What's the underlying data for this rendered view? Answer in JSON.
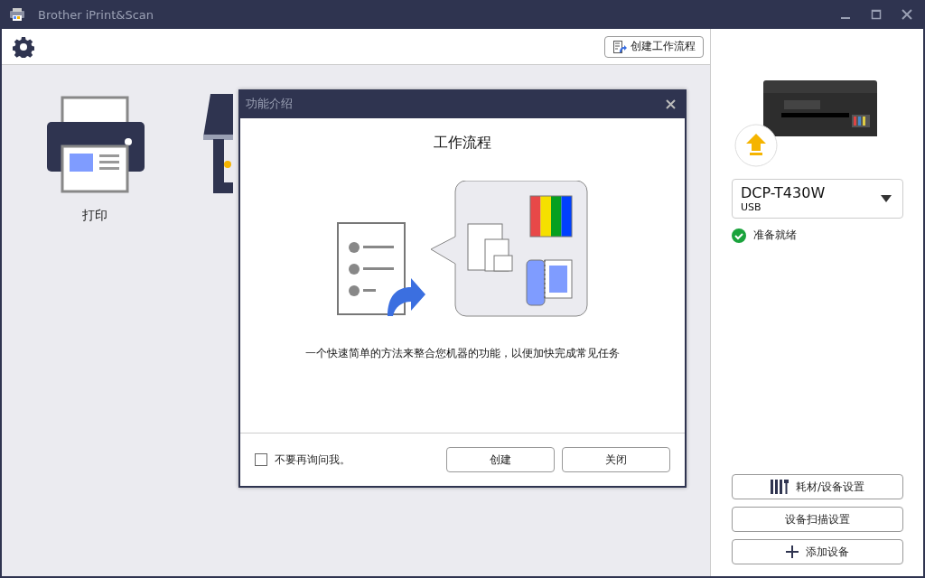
{
  "window": {
    "title": "Brother iPrint&Scan"
  },
  "toolbar": {
    "create_workflow_button": "创建工作流程"
  },
  "tiles": [
    {
      "label": "打印"
    }
  ],
  "dialog": {
    "title": "功能介绍",
    "heading": "工作流程",
    "description": "一个快速简单的方法来整合您机器的功能，以便加快完成常见任务",
    "dont_ask_again": {
      "label": "不要再询问我。",
      "checked": false
    },
    "buttons": [
      "创建",
      "关闭"
    ]
  },
  "device": {
    "model": "DCP-T430W",
    "connection": "USB",
    "status": "准备就绪"
  },
  "side_buttons": [
    {
      "kind": "supplies",
      "label": "耗材/设备设置"
    },
    {
      "kind": "plain",
      "label": "设备扫描设置"
    },
    {
      "kind": "add",
      "label": "添加设备"
    }
  ]
}
